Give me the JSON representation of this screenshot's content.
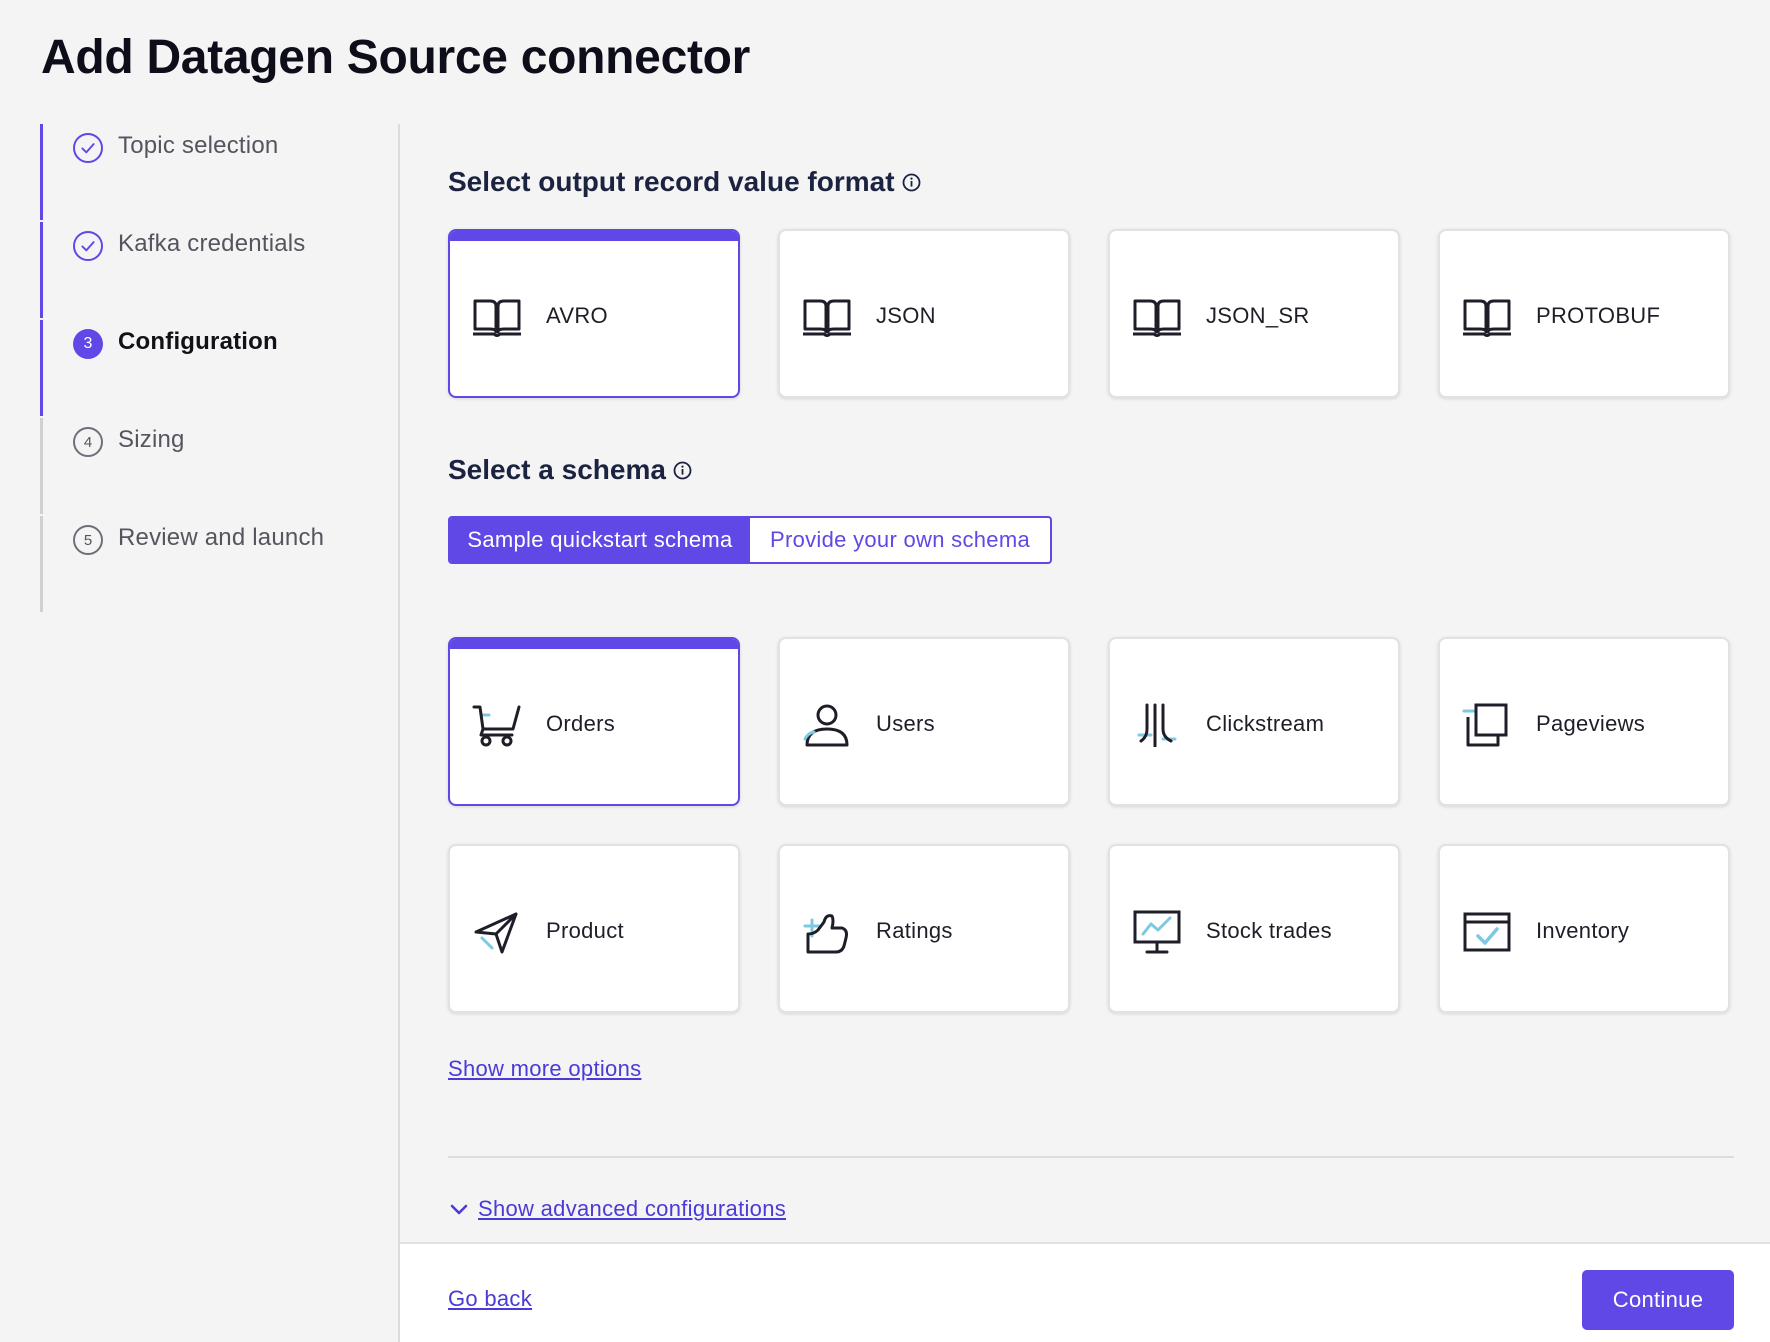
{
  "page": {
    "title": "Add Datagen Source connector"
  },
  "steps": [
    {
      "label": "Topic selection",
      "number": "1",
      "state": "done"
    },
    {
      "label": "Kafka credentials",
      "number": "2",
      "state": "done"
    },
    {
      "label": "Configuration",
      "number": "3",
      "state": "active"
    },
    {
      "label": "Sizing",
      "number": "4",
      "state": "todo"
    },
    {
      "label": "Review and launch",
      "number": "5",
      "state": "todo"
    }
  ],
  "format_section": {
    "heading": "Select output record value format",
    "options": [
      {
        "label": "AVRO",
        "icon": "book-icon",
        "selected": true
      },
      {
        "label": "JSON",
        "icon": "book-icon",
        "selected": false
      },
      {
        "label": "JSON_SR",
        "icon": "book-icon",
        "selected": false
      },
      {
        "label": "PROTOBUF",
        "icon": "book-icon",
        "selected": false
      }
    ]
  },
  "schema_section": {
    "heading": "Select a schema",
    "toggle": {
      "sample": "Sample quickstart schema",
      "own": "Provide your own schema",
      "selected": "sample"
    },
    "options": [
      {
        "label": "Orders",
        "icon": "cart-icon",
        "selected": true
      },
      {
        "label": "Users",
        "icon": "user-icon",
        "selected": false
      },
      {
        "label": "Clickstream",
        "icon": "clickstream-icon",
        "selected": false
      },
      {
        "label": "Pageviews",
        "icon": "pages-icon",
        "selected": false
      },
      {
        "label": "Product",
        "icon": "send-icon",
        "selected": false
      },
      {
        "label": "Ratings",
        "icon": "thumbs-icon",
        "selected": false
      },
      {
        "label": "Stock trades",
        "icon": "monitor-chart-icon",
        "selected": false
      },
      {
        "label": "Inventory",
        "icon": "inventory-icon",
        "selected": false
      }
    ],
    "show_more": "Show more options"
  },
  "advanced": {
    "label": "Show advanced configurations"
  },
  "footer": {
    "go_back": "Go back",
    "continue": "Continue"
  },
  "colors": {
    "accent": "#5f48e6",
    "link": "#4a3ad8",
    "icon_highlight": "#7ec8e3"
  }
}
